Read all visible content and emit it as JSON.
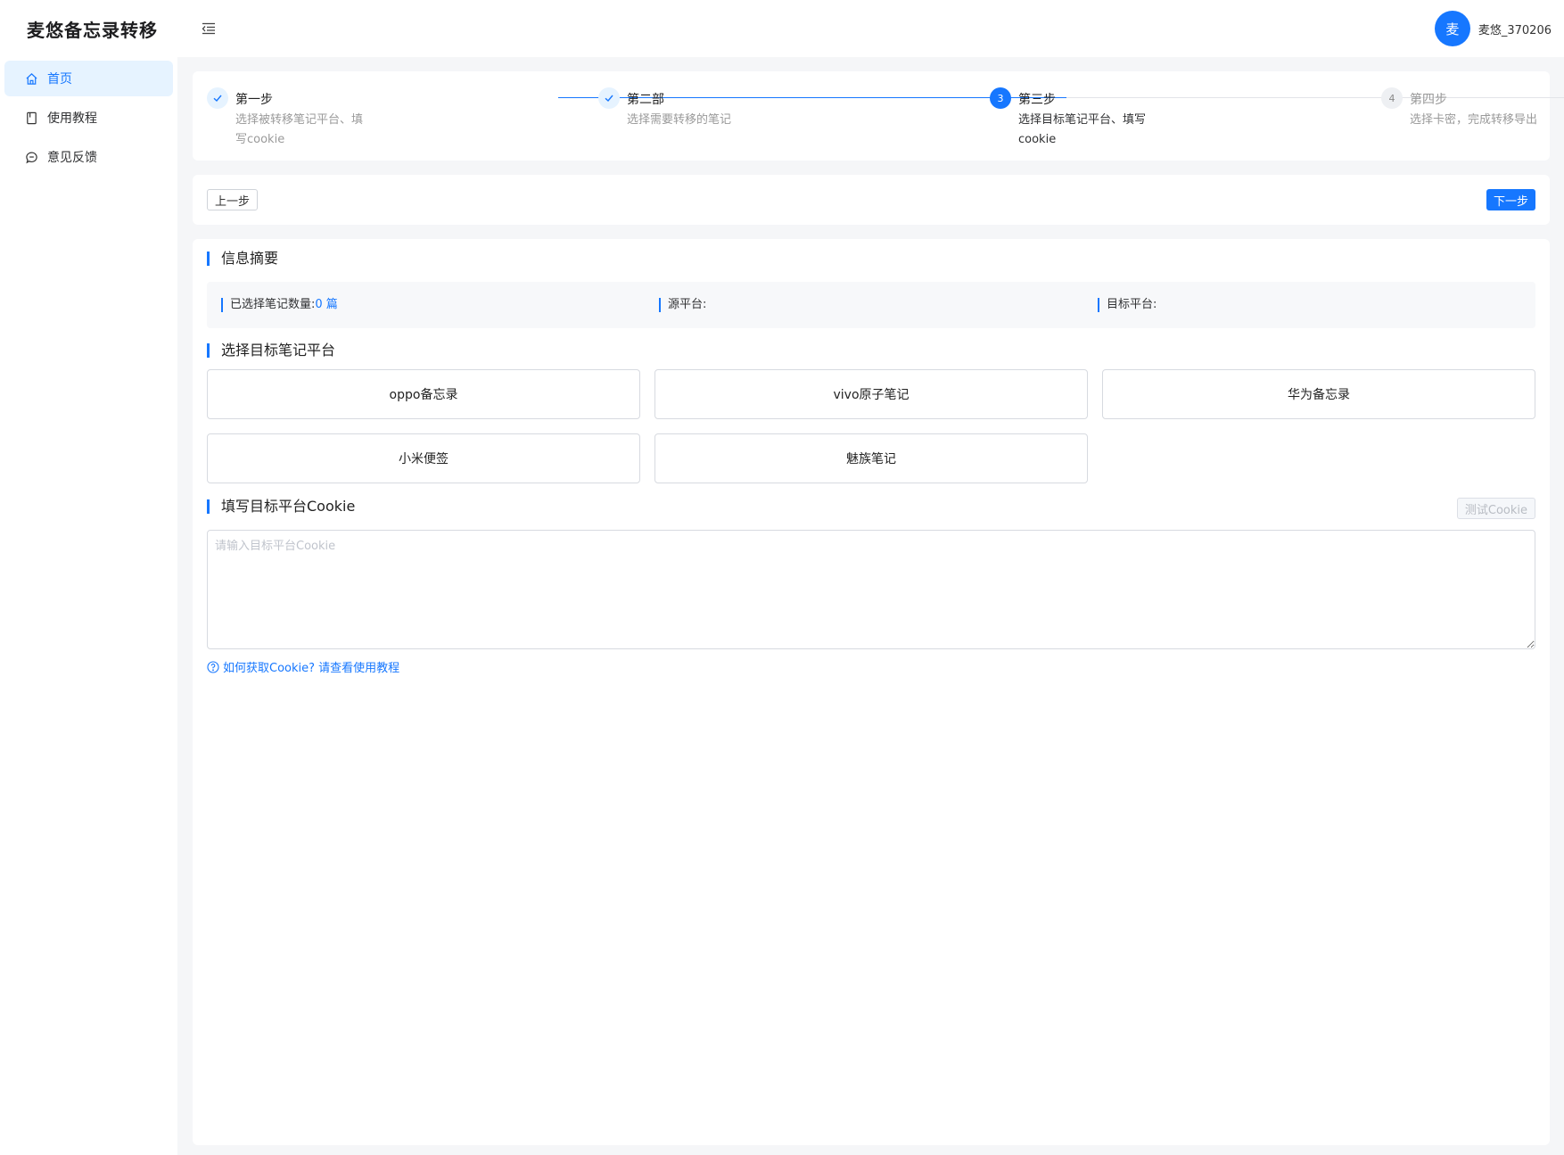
{
  "header": {
    "brand": "麦悠备忘录转移",
    "user": {
      "avatar_text": "麦",
      "name": "麦悠_370206"
    }
  },
  "sidebar": {
    "items": [
      {
        "label": "首页",
        "icon": "home-icon",
        "active": true
      },
      {
        "label": "使用教程",
        "icon": "book-icon",
        "active": false
      },
      {
        "label": "意见反馈",
        "icon": "chat-icon",
        "active": false
      }
    ]
  },
  "steps": [
    {
      "index": "1",
      "title": "第一步",
      "desc": "选择被转移笔记平台、填写cookie",
      "status": "done"
    },
    {
      "index": "2",
      "title": "第二部",
      "desc": "选择需要转移的笔记",
      "status": "done"
    },
    {
      "index": "3",
      "title": "第三步",
      "desc": "选择目标笔记平台、填写cookie",
      "status": "current"
    },
    {
      "index": "4",
      "title": "第四步",
      "desc": "选择卡密，完成转移导出",
      "status": "wait"
    }
  ],
  "actions": {
    "prev": "上一步",
    "next": "下一步"
  },
  "summary": {
    "title": "信息摘要",
    "selected_label": "已选择笔记数量:",
    "selected_count": "0 篇",
    "source_label": "源平台:",
    "target_label": "目标平台:"
  },
  "target_platform": {
    "title": "选择目标笔记平台",
    "options": [
      "oppo备忘录",
      "vivo原子笔记",
      "华为备忘录",
      "小米便签",
      "魅族笔记"
    ]
  },
  "cookie": {
    "title": "填写目标平台Cookie",
    "test_button": "测试Cookie",
    "placeholder": "请输入目标平台Cookie",
    "help_link": "如何获取Cookie? 请查看使用教程"
  },
  "colors": {
    "accent": "#1677ff",
    "active_bg": "#e6f3ff"
  }
}
